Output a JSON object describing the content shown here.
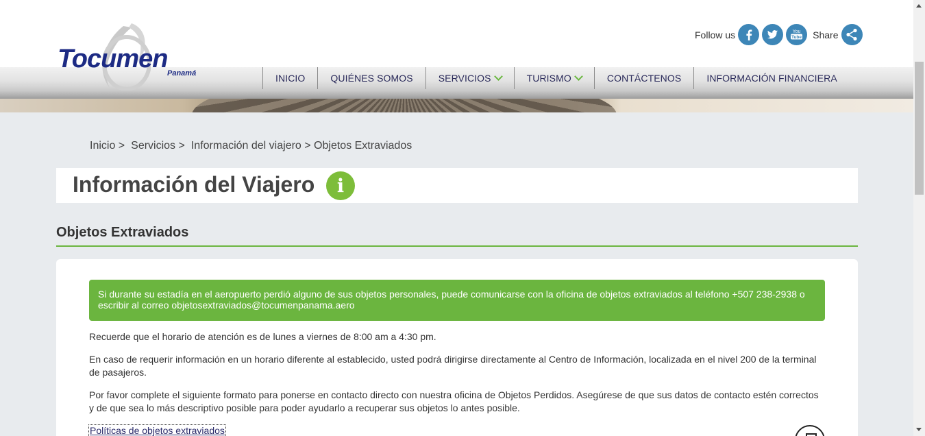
{
  "header": {
    "logo_text": "Tocumen",
    "logo_sub": "Panamá",
    "follow_label": "Follow us",
    "share_label": "Share",
    "social_icons": [
      "facebook-icon",
      "twitter-icon",
      "youtube-icon",
      "share-icon"
    ]
  },
  "nav": {
    "items": [
      {
        "label": "INICIO"
      },
      {
        "label": "QUIÉNES SOMOS"
      },
      {
        "label": "SERVICIOS"
      },
      {
        "label": "TURISMO"
      },
      {
        "label": "CONTÁCTENOS"
      },
      {
        "label": "INFORMACIÓN FINANCIERA"
      }
    ]
  },
  "breadcrumb": {
    "items": [
      "Inicio >",
      "Servicios >",
      "Información del viajero > Objetos Extraviados"
    ]
  },
  "page": {
    "title": "Información del Viajero",
    "info_icon_glyph": "i",
    "section_title": "Objetos Extraviados",
    "alert": "Si durante su estadía en el aeropuerto perdió alguno de sus objetos personales, puede comunicarse con la oficina de objetos extraviados al teléfono +507 238-2938 o escribir al correo objetosextraviados@tocumenpanama.aero",
    "p1": "Recuerde que el horario de atención es de lunes a viernes de 8:00 am a 4:30 pm.",
    "p2": "En caso de requerir información en un horario diferente al establecido, usted podrá dirigirse directamente al Centro de Información, localizada en el nivel 200 de la terminal de pasajeros.",
    "p3": "Por favor complete el siguiente formato para ponerse en contacto directo con nuestra oficina de Objetos Perdidos. Asegúrese de que sus datos de contacto estén correctos y de que sea lo más descriptivo posible para poder ayudarlo a recuperar sus objetos lo antes posible.",
    "policy_link": "Políticas de objetos extraviados"
  },
  "colors": {
    "brand_blue": "#1d2b84",
    "accent_green": "#6bb53f",
    "social_blue": "#3d86b7"
  }
}
